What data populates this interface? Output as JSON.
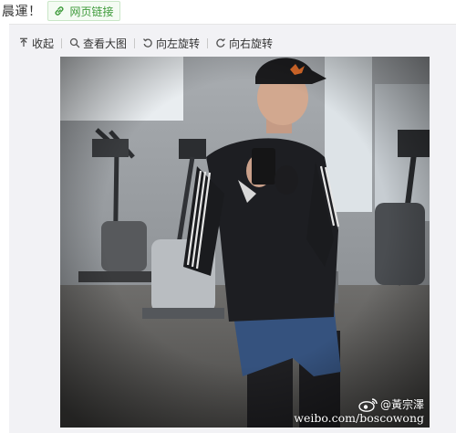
{
  "post": {
    "text": "晨運！"
  },
  "web_link": {
    "label": "网页链接",
    "icon": "link-icon"
  },
  "toolbar": {
    "collapse_label": "收起",
    "view_large_label": "查看大图",
    "rotate_left_label": "向左旋转",
    "rotate_right_label": "向右旋转"
  },
  "photo": {
    "watermark_user": "@黃宗澤",
    "watermark_url": "weibo.com/boscowong"
  },
  "colors": {
    "link_green": "#3d9a3a",
    "panel_bg": "#f2f2f5"
  }
}
